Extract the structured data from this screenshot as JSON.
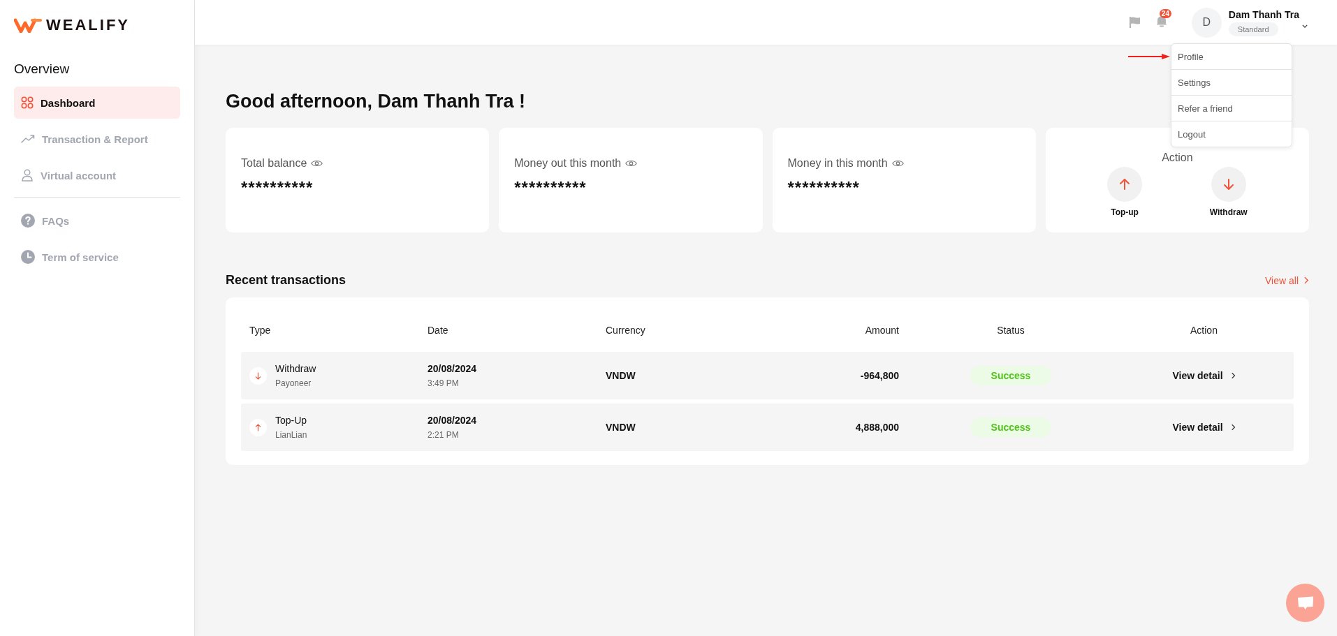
{
  "brand": "WEALIFY",
  "sidebar": {
    "section_title": "Overview",
    "items": [
      {
        "label": "Dashboard",
        "kind": "grid",
        "selected": true
      },
      {
        "label": "Transaction & Report",
        "kind": "trend",
        "selected": false
      },
      {
        "label": "Virtual account",
        "kind": "user",
        "selected": false
      }
    ],
    "secondary_items": [
      {
        "label": "FAQs",
        "kind": "question",
        "selected": false
      },
      {
        "label": "Term of service",
        "kind": "clock",
        "selected": false
      }
    ]
  },
  "header": {
    "notification_count": "24",
    "avatar_initial": "D",
    "user_name": "Dam Thanh Tra",
    "plan": "Standard"
  },
  "user_menu": [
    {
      "label": "Profile"
    },
    {
      "label": "Settings"
    },
    {
      "label": "Refer a friend"
    },
    {
      "label": "Logout"
    }
  ],
  "greeting": "Good afternoon, Dam Thanh Tra !",
  "cards": [
    {
      "label": "Total balance",
      "value": "**********"
    },
    {
      "label": "Money out this month",
      "value": "**********"
    },
    {
      "label": "Money in this month",
      "value": "**********"
    }
  ],
  "actions": {
    "title": "Action",
    "buttons": [
      {
        "label": "Top-up",
        "kind": "up"
      },
      {
        "label": "Withdraw",
        "kind": "down"
      }
    ]
  },
  "transactions": {
    "title": "Recent transactions",
    "view_all": "View all",
    "columns": [
      "Type",
      "Date",
      "Currency",
      "Amount",
      "Status",
      "Action"
    ],
    "rows": [
      {
        "kind": "down",
        "type": "Withdraw",
        "provider": "Payoneer",
        "date": "20/08/2024",
        "time": "3:49 PM",
        "currency": "VNDW",
        "amount": "-964,800",
        "status": "Success",
        "action": "View detail"
      },
      {
        "kind": "up",
        "type": "Top-Up",
        "provider": "LianLian",
        "date": "20/08/2024",
        "time": "2:21 PM",
        "currency": "VNDW",
        "amount": "4,888,000",
        "status": "Success",
        "action": "View detail"
      }
    ]
  }
}
